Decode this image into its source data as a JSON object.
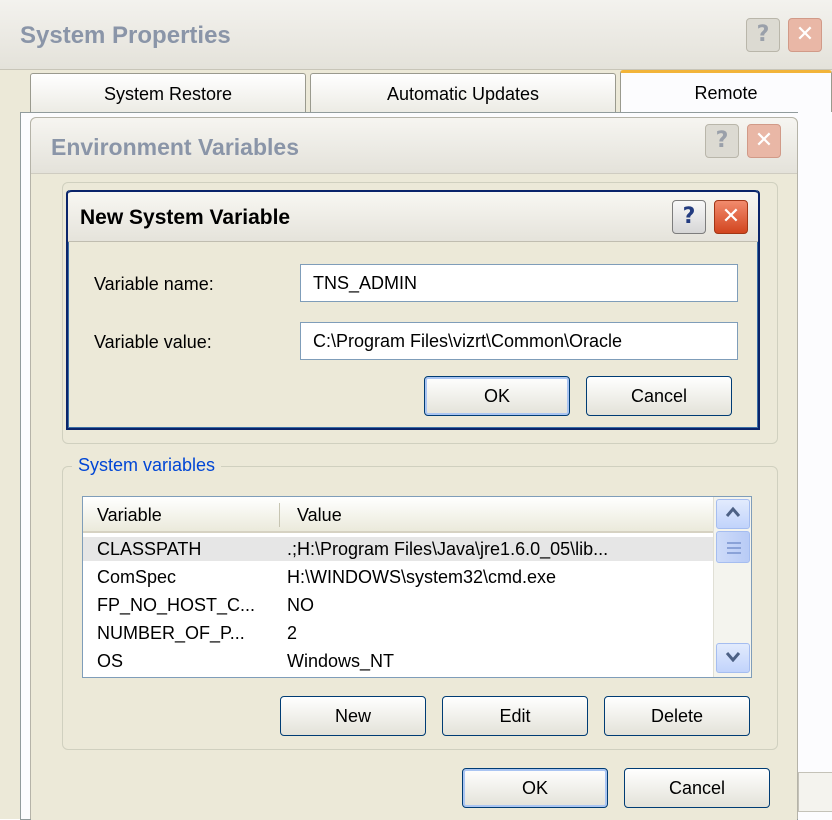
{
  "system_properties": {
    "title": "System Properties",
    "tabs": [
      "System Restore",
      "Automatic Updates",
      "Remote"
    ],
    "help_glyph": "?",
    "close_glyph": "✕"
  },
  "env_vars": {
    "title": "Environment Variables",
    "help_glyph": "?",
    "close_glyph": "✕",
    "system_variables_label": "System variables",
    "columns": [
      "Variable",
      "Value"
    ],
    "rows": [
      {
        "variable": "CLASSPATH",
        "value": ".;H:\\Program Files\\Java\\jre1.6.0_05\\lib..."
      },
      {
        "variable": "ComSpec",
        "value": "H:\\WINDOWS\\system32\\cmd.exe"
      },
      {
        "variable": "FP_NO_HOST_C...",
        "value": "NO"
      },
      {
        "variable": "NUMBER_OF_P...",
        "value": "2"
      },
      {
        "variable": "OS",
        "value": "Windows_NT"
      }
    ],
    "buttons": {
      "new": "New",
      "edit": "Edit",
      "delete": "Delete",
      "ok": "OK",
      "cancel": "Cancel"
    }
  },
  "new_var": {
    "title": "New System Variable",
    "help_glyph": "?",
    "close_glyph": "✕",
    "name_label": "Variable name:",
    "name_value": "TNS_ADMIN",
    "value_label": "Variable value:",
    "value_value": "C:\\Program Files\\vizrt\\Common\\Oracle",
    "ok": "OK",
    "cancel": "Cancel"
  }
}
